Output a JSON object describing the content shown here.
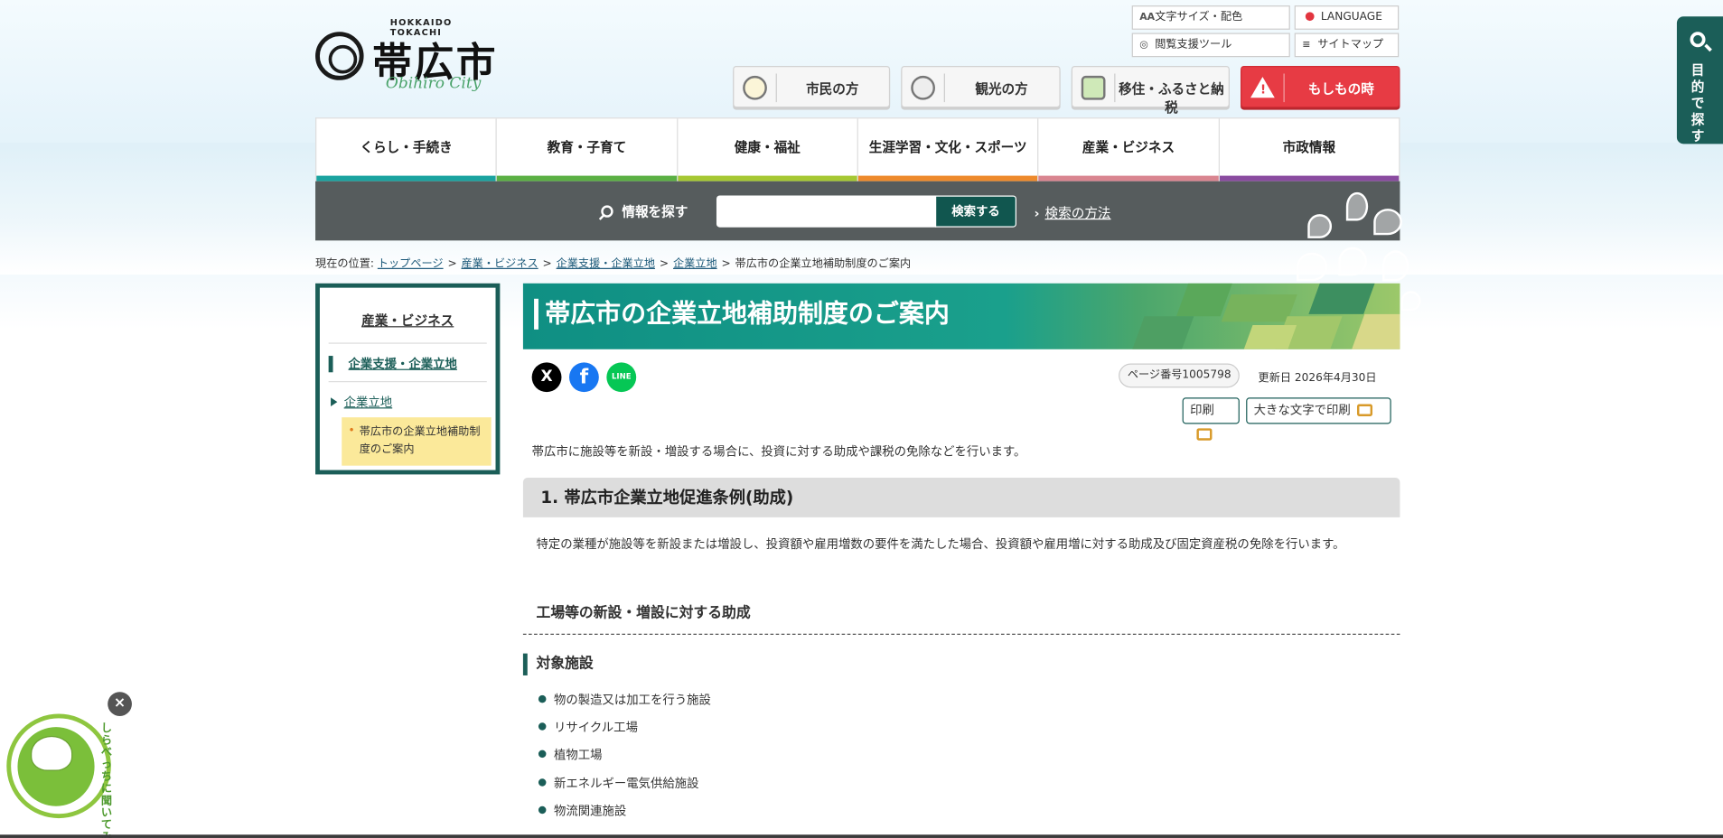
{
  "header": {
    "logo_en_top": "HOKKAIDO TOKACHI",
    "logo_jp": "帯広市",
    "logo_en": "Obihiro City",
    "util": {
      "font_size": "文字サイズ・配色",
      "font_size_icon": "AA",
      "language": "LANGUAGE",
      "browse_tools": "閲覧支援ツール",
      "sitemap": "サイトマップ"
    },
    "buttons": {
      "citizen": "市民の方",
      "tourist": "観光の方",
      "relocation": "移住・ふるさと納税",
      "emergency": "もしもの時"
    },
    "side_tab": "目的で探す"
  },
  "nav": [
    {
      "label": "くらし・手続き",
      "color": "#1aa3a0"
    },
    {
      "label": "教育・子育て",
      "color": "#5bb044"
    },
    {
      "label": "健康・福祉",
      "color": "#a6c833"
    },
    {
      "label": "生涯学習・文化・スポーツ",
      "color": "#ee8a2c"
    },
    {
      "label": "産業・ビジネス",
      "color": "#d98590"
    },
    {
      "label": "市政情報",
      "color": "#8a4ba0"
    }
  ],
  "search": {
    "label": "情報を探す",
    "button": "検索する",
    "how": "検索の方法",
    "value": ""
  },
  "breadcrumb": {
    "prefix": "現在の位置:",
    "items": [
      "トップページ",
      "産業・ビジネス",
      "企業支援・企業立地",
      "企業立地"
    ],
    "current": "帯広市の企業立地補助制度のご案内",
    "separator": ">"
  },
  "local_nav": {
    "title": "産業・ビジネス",
    "level1": "企業支援・企業立地",
    "level2": "企業立地",
    "current": "帯広市の企業立地補助制度のご案内"
  },
  "page": {
    "title": "帯広市の企業立地補助制度のご案内",
    "page_number": "ページ番号1005798",
    "updated": "更新日 2026年4月30日",
    "print": "印刷",
    "print_large": "大きな文字で印刷",
    "lead": "帯広市に施設等を新設・増設する場合に、投資に対する助成や課税の免除などを行います。",
    "h2": "1. 帯広市企業立地促進条例(助成)",
    "para": "特定の業種が施設等を新設または増設し、投資額や雇用増数の要件を満たした場合、投資額や雇用増に対する助成及び固定資産税の免除を行います。",
    "h3": "工場等の新設・増設に対する助成",
    "h4": "対象施設",
    "facilities": [
      "物の製造又は加工を行う施設",
      "リサイクル工場",
      "植物工場",
      "新エネルギー電気供給施設",
      "物流関連施設"
    ]
  },
  "sns": {
    "x": "X",
    "facebook": "f",
    "line": "LINE"
  },
  "mascot": {
    "text": "しらべっちに聞いてみる!",
    "close": "×"
  },
  "colors": {
    "primary": "#1b5e58",
    "emergency": "#e73b44",
    "search_bg": "#565c5d"
  }
}
